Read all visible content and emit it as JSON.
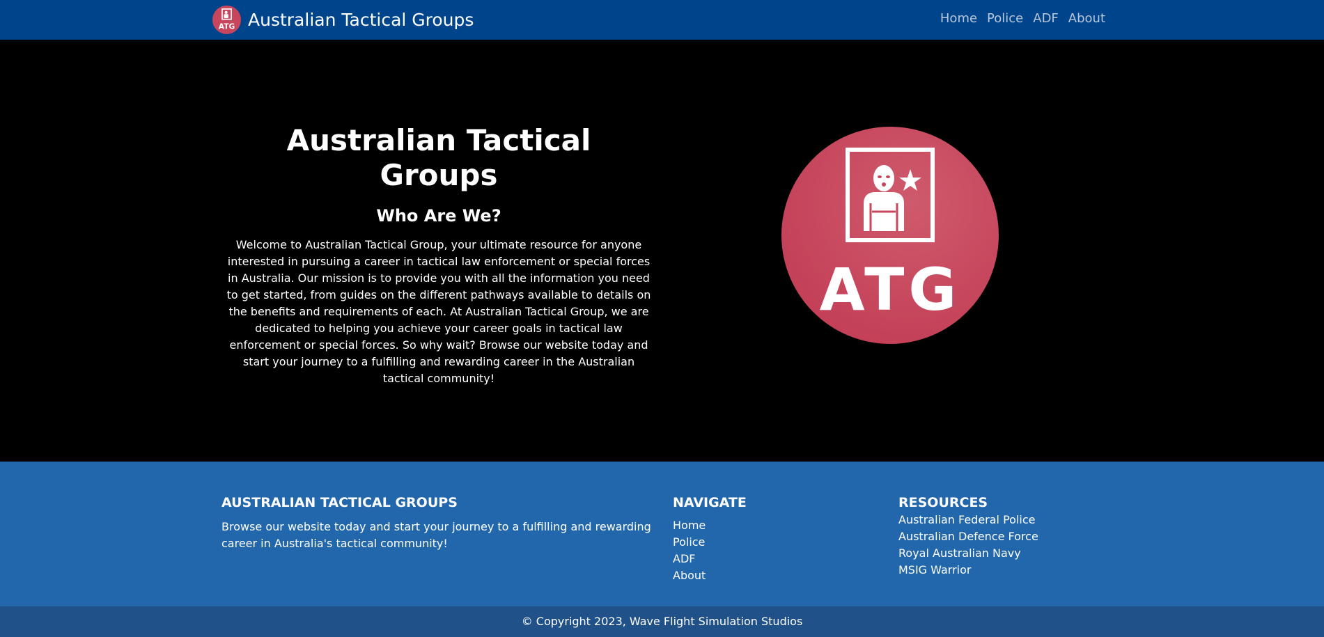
{
  "navbar": {
    "brand_title": "Australian Tactical Groups",
    "logo_icon": "atg-logo-icon",
    "links": [
      {
        "label": "Home"
      },
      {
        "label": "Police"
      },
      {
        "label": "ADF"
      },
      {
        "label": "About"
      }
    ]
  },
  "hero": {
    "title": "Australian Tactical Groups",
    "subtitle": "Who Are We?",
    "body": "Welcome to Australian Tactical Group, your ultimate resource for anyone interested in pursuing a career in tactical law enforcement or special forces in Australia. Our mission is to provide you with all the information you need to get started, from guides on the different pathways available to details on the benefits and requirements of each. At Australian Tactical Group, we are dedicated to helping you achieve your career goals in tactical law enforcement or special forces. So why wait? Browse our website today and start your journey to a fulfilling and rewarding career in the Australian tactical community!",
    "logo_icon": "atg-logo-icon",
    "logo_text": "ATG"
  },
  "footer": {
    "about_heading": "AUSTRALIAN TACTICAL GROUPS",
    "about_text": "Browse our website today and start your journey to a fulfilling and rewarding career in Australia's tactical community!",
    "navigate_heading": "NAVIGATE",
    "navigate_links": [
      {
        "label": "Home"
      },
      {
        "label": "Police"
      },
      {
        "label": "ADF"
      },
      {
        "label": "About"
      }
    ],
    "resources_heading": "RESOURCES",
    "resources_links": [
      {
        "label": "Australian Federal Police"
      },
      {
        "label": "Australian Defence Force"
      },
      {
        "label": "Royal Australian Navy"
      },
      {
        "label": "MSIG Warrior"
      }
    ],
    "copyright": "© Copyright 2023, Wave Flight Simulation Studios"
  },
  "colors": {
    "navbar_bg": "#00458c",
    "footer_bg": "#2267ac",
    "copyright_bg": "#205189",
    "logo_red": "#c8465c",
    "hero_bg": "#000000"
  }
}
